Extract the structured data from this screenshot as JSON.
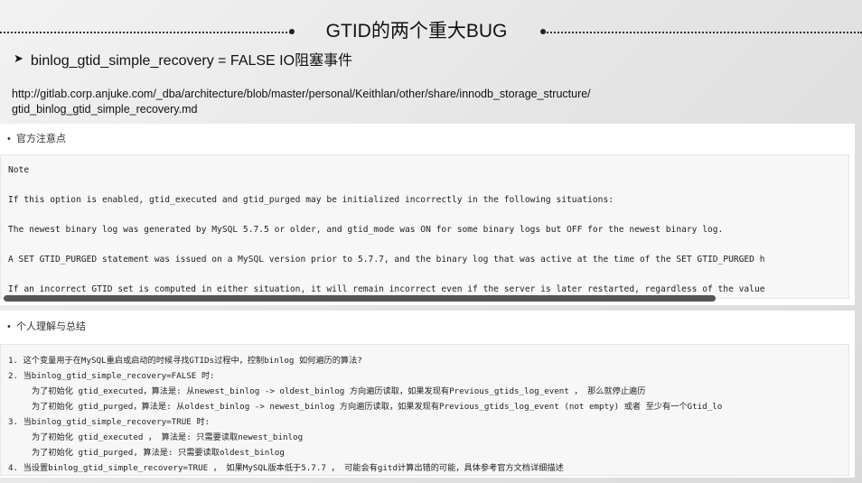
{
  "slide": {
    "title": "GTID的两个重大BUG",
    "bullet": "binlog_gtid_simple_recovery = FALSE IO阻塞事件",
    "link_line1": "http://gitlab.corp.anjuke.com/_dba/architecture/blob/master/personal/Keithlan/other/share/innodb_storage_structure/",
    "link_line2": "gtid_binlog_gtid_simple_recovery.md"
  },
  "official": {
    "heading": "官方注意点",
    "lines": [
      "Note",
      "If this option is enabled, gtid_executed and gtid_purged may be initialized incorrectly in the following situations:",
      "The newest binary log was generated by MySQL 5.7.5 or older, and gtid_mode was ON for some binary logs but OFF for the newest binary log.",
      "A SET GTID_PURGED statement was issued on a MySQL version prior to 5.7.7, and the binary log that was active at the time of the SET GTID_PURGED h",
      "If an incorrect GTID set is computed in either situation, it will remain incorrect even if the server is later restarted, regardless of the value"
    ]
  },
  "personal": {
    "heading": "个人理解与总结",
    "lines": [
      "1. 这个变量用于在MySQL重启或启动的时候寻找GTIDs过程中，控制binlog 如何遍历的算法?",
      "2. 当binlog_gtid_simple_recovery=FALSE 时:",
      "为了初始化 gtid_executed，算法是:  从newest_binlog -> oldest_binlog 方向遍历读取，如果发现有Previous_gtids_log_event ，  那么就停止遍历",
      "为了初始化 gtid_purged，算法是:    从oldest_binlog -> newest_binlog 方向遍历读取，如果发现有Previous_gtids_log_event (not empty) 或者 至少有一个Gtid_lo",
      "3. 当binlog_gtid_simple_recovery=TRUE 时:",
      "为了初始化 gtid_executed ，  算法是:  只需要读取newest_binlog",
      "为了初始化 gtid_purged,  算法是:  只需要读取oldest_binlog",
      "4. 当设置binlog_gtid_simple_recovery=TRUE ，  如果MySQL版本低于5.7.7 ，  可能会有gitd计算出错的可能，具体参考官方文档详细描述"
    ]
  }
}
